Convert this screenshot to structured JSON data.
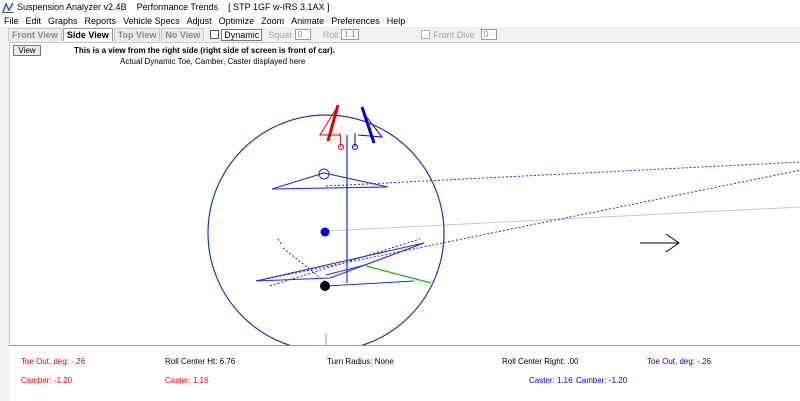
{
  "window": {
    "title": "Suspension Analyzer v2.4B    Performance Trends    [ STP 1GF w-IRS 3.1AX ]"
  },
  "menu": [
    "File",
    "Edit",
    "Graphs",
    "Reports",
    "Vehicle Specs",
    "Adjust",
    "Optimize",
    "Zoom",
    "Animate",
    "Preferences",
    "Help"
  ],
  "toolbar": {
    "tabs": [
      "Front View",
      "Side View",
      "Top View",
      "No View"
    ],
    "active_tab": "Side View",
    "dynamic_label": "Dynamic",
    "squat_label": "Squat",
    "squat_value": "0",
    "roll_label": "Roll",
    "roll_value": "1.1",
    "front_dive_label": "Front Dive",
    "front_dive_value": "0"
  },
  "canvas": {
    "view_button": "View",
    "message_line1": "This is a view from the right side (right side of screen is front of car).",
    "message_line2": "Actual Dynamic Toe, Camber, Caster displayed here"
  },
  "readouts": {
    "toe_left": "Toe Out, deg: -.26",
    "camber_left": "Camber: -1.20",
    "roll_center": "Roll Center Ht: 6.76",
    "caster_left": "Caster: 1.16",
    "turn_radius": "Turn Radius: None",
    "roll_center_right": "Roll Center Right: .00",
    "toe_right": "Toe Out, deg: -.26",
    "caster_right": "Caster: 1.16",
    "camber_right": "Camber: -1.20"
  },
  "colors": {
    "left_side": "#e00000",
    "right_side": "#0000d0",
    "geometry": "#1f2fd6",
    "green_line": "#00c000"
  }
}
